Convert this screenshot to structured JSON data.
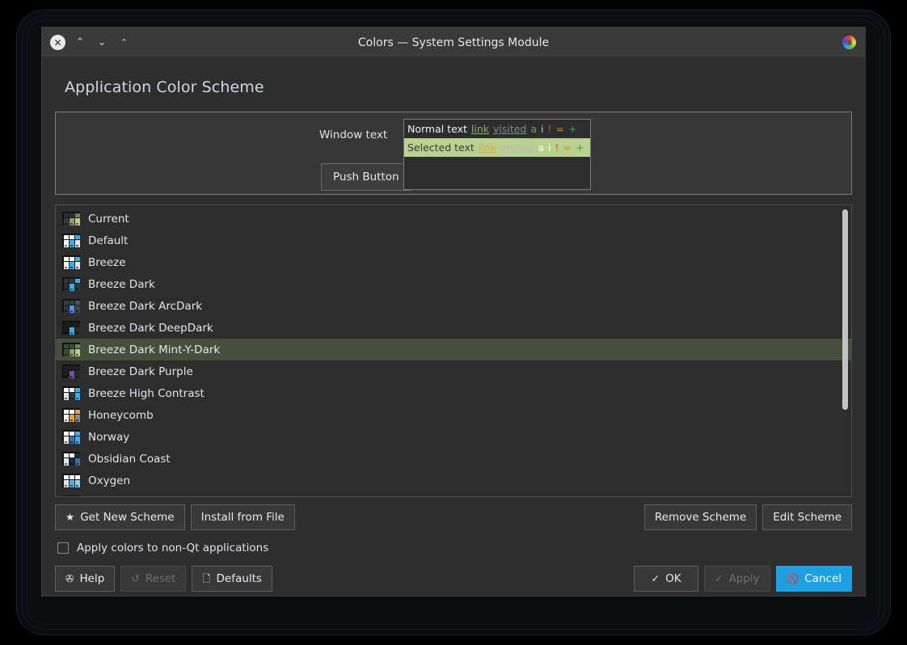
{
  "window": {
    "title": "Colors — System Settings Module",
    "titlebar_buttons": [
      {
        "name": "close",
        "glyph": "✕"
      },
      {
        "name": "chevron-up",
        "glyph": "⌃"
      },
      {
        "name": "chevron-down",
        "glyph": "⌄"
      },
      {
        "name": "chevrons-up",
        "glyph": "⌃"
      }
    ],
    "app_icon": "color-wheel-icon"
  },
  "page_title": "Application Color Scheme",
  "preview": {
    "window_text_label": "Window text",
    "push_button_label": "Push Button",
    "rows": [
      {
        "state": "normal",
        "text": "Normal text",
        "link": "link",
        "visited": "visited",
        "a": "a",
        "i": "i",
        "negative": "!",
        "neutral": "=",
        "positive": "+"
      },
      {
        "state": "selected",
        "text": "Selected text",
        "link": "link",
        "visited": "visited",
        "a": "a",
        "i": "i",
        "negative": "!",
        "neutral": "=",
        "positive": "+"
      }
    ],
    "colors": {
      "selection_background": "#b7d18e",
      "normal_background": "#2d2d2d",
      "link_normal": "#8ab36a",
      "link_selected": "#e8a33d",
      "negative": "#e8433a",
      "neutral": "#d78b2f",
      "positive": "#3fa34a"
    }
  },
  "scheme_list": {
    "selected_index": 6,
    "selection_color": "#44503b",
    "items": [
      {
        "label": "Current",
        "titlebar": [
          "#2f2f2f",
          "#2f2f2f",
          "#6f7f62"
        ],
        "panes": [
          "#3a3a3a",
          "#8aa074",
          "#b7d18e"
        ]
      },
      {
        "label": "Default",
        "titlebar": [
          "#ffffff",
          "#ffffff",
          "#3daee9"
        ],
        "panes": [
          "#ffffff",
          "#3daee9",
          "#dfe4e9"
        ]
      },
      {
        "label": "Breeze",
        "titlebar": [
          "#ffffff",
          "#ffffff",
          "#3daee9"
        ],
        "panes": [
          "#ffffff",
          "#3daee9",
          "#dfe4e9"
        ]
      },
      {
        "label": "Breeze Dark",
        "titlebar": [
          "#31363b",
          "#31363b",
          "#3daee9"
        ],
        "panes": [
          "#2a2e32",
          "#3daee9",
          "#31363b"
        ]
      },
      {
        "label": "Breeze Dark ArcDark",
        "titlebar": [
          "#383c45",
          "#383c45",
          "#4b5162"
        ],
        "panes": [
          "#2f343f",
          "#5294e2",
          "#404552"
        ]
      },
      {
        "label": "Breeze Dark DeepDark",
        "titlebar": [
          "#1b1b1b",
          "#1b1b1b",
          "#1b1b1b"
        ],
        "panes": [
          "#1b1b1b",
          "#3daee9",
          "#2b2b2b"
        ]
      },
      {
        "label": "Breeze Dark Mint-Y-Dark",
        "titlebar": [
          "#3f4a38",
          "#3f4a38",
          "#6f7f62"
        ],
        "panes": [
          "#404a38",
          "#8aa074",
          "#b7d18e"
        ]
      },
      {
        "label": "Breeze Dark Purple",
        "titlebar": [
          "#1e1e1e",
          "#1e1e1e",
          "#1e1e1e"
        ],
        "panes": [
          "#1e1e1e",
          "#7b50a8",
          "#2b2b2b"
        ]
      },
      {
        "label": "Breeze High Contrast",
        "titlebar": [
          "#ffffff",
          "#ffffff",
          "#3daee9"
        ],
        "panes": [
          "#dfe4e9",
          "#31363b",
          "#3daee9"
        ]
      },
      {
        "label": "Honeycomb",
        "titlebar": [
          "#ffffff",
          "#ffffff",
          "#e8a33d"
        ],
        "panes": [
          "#ffffff",
          "#e8a33d",
          "#8a8a8a"
        ]
      },
      {
        "label": "Norway",
        "titlebar": [
          "#ffffff",
          "#ffffff",
          "#3daee9"
        ],
        "panes": [
          "#efe9e0",
          "#3a6ea5",
          "#3daee9"
        ]
      },
      {
        "label": "Obsidian Coast",
        "titlebar": [
          "#ffffff",
          "#ffffff",
          "#1d2b3a"
        ],
        "panes": [
          "#dfe4e9",
          "#1d2b3a",
          "#3a6ea5"
        ]
      },
      {
        "label": "Oxygen",
        "titlebar": [
          "#ffffff",
          "#ffffff",
          "#ffffff"
        ],
        "panes": [
          "#dfe4e9",
          "#58b0e8",
          "#8fd0f0"
        ]
      },
      {
        "label": "",
        "titlebar": [
          "#ffffff",
          "#ffffff",
          "#3daee9"
        ],
        "panes": [
          "#ffffff",
          "#e8a33d",
          "#d78b2f"
        ]
      }
    ]
  },
  "mid_bar": {
    "get_new_scheme": {
      "label": "Get New Scheme",
      "icon": "★"
    },
    "install_from_file": {
      "label": "Install from File"
    },
    "remove_scheme": {
      "label": "Remove Scheme"
    },
    "edit_scheme": {
      "label": "Edit Scheme"
    }
  },
  "checkbox": {
    "label": "Apply colors to non-Qt applications",
    "checked": false
  },
  "bottom_bar": {
    "help": {
      "label": "Help",
      "icon": "✇"
    },
    "reset": {
      "label": "Reset",
      "icon": "↺",
      "enabled": false
    },
    "defaults": {
      "label": "Defaults",
      "icon": "🗋"
    },
    "ok": {
      "label": "OK",
      "icon": "✓"
    },
    "apply": {
      "label": "Apply",
      "icon": "✓",
      "enabled": false
    },
    "cancel": {
      "label": "Cancel",
      "icon": "🚫",
      "accent": "#1da0e2"
    }
  }
}
